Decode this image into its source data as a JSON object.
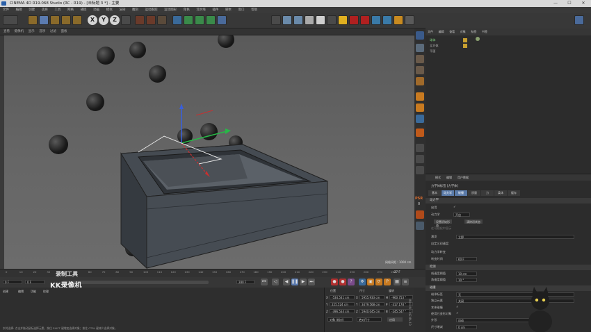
{
  "window": {
    "title": "CINEMA 4D R19.068 Studio (RC - R19) - [未标题 3 *] - 主要",
    "controls": [
      "—",
      "☐",
      "✕"
    ]
  },
  "menu": [
    "文件",
    "编辑",
    "创建",
    "选择",
    "工具",
    "网格",
    "捕捉",
    "动画",
    "模拟",
    "渲染",
    "雕刻",
    "运动跟踪",
    "运动图形",
    "角色",
    "流水线",
    "插件",
    "脚本",
    "窗口",
    "帮助"
  ],
  "toolbar": {
    "axis_x": "X",
    "axis_y": "Y",
    "axis_z": "Z"
  },
  "viewport": {
    "menu": [
      "查看",
      "摄像机",
      "显示",
      "选项",
      "过滤",
      "面板"
    ],
    "grid_label": "网格间距 : 1000 cm"
  },
  "objects": {
    "tabs": [
      "文件",
      "编辑",
      "查看",
      "对象",
      "标签",
      "书签"
    ],
    "items": [
      "球体",
      "立方体",
      "平面"
    ]
  },
  "attributes": {
    "menu": [
      "模式",
      "编辑",
      "用户数据"
    ],
    "title": "力学体标签 [力学体]",
    "tabs": [
      "基本",
      "动力学",
      "碰撞",
      "质量",
      "力",
      "柔体",
      "缓存"
    ],
    "section_dynamics": "动力学",
    "rows": [
      {
        "label": "启用",
        "value": "✓"
      },
      {
        "label": "动力学",
        "value": "开启"
      },
      {
        "label": "设置初始形态",
        "value": "清除初状态"
      },
      {
        "label": "在可视化中显示",
        "value": ""
      },
      {
        "label": "激发",
        "value": "立即"
      },
      {
        "label": "自定义初速度",
        "value": ""
      },
      {
        "label": "动力学转变",
        "value": ""
      },
      {
        "label": "转变时间",
        "value": "60 F"
      }
    ],
    "section_threshold": "检测",
    "threshold_rows": [
      {
        "label": "线速度阈值",
        "value": "10 cm"
      },
      {
        "label": "角速度阈值",
        "value": "10 °"
      }
    ],
    "section_collision": "碰撞",
    "collision_rows": [
      {
        "label": "继承标签",
        "value": "无"
      },
      {
        "label": "独立元素",
        "value": "关闭"
      },
      {
        "label": "本体碰撞",
        "value": "✓"
      },
      {
        "label": "使用已变形对象",
        "value": "✓"
      },
      {
        "label": "外形",
        "value": "自动"
      },
      {
        "label": "尺寸增减",
        "value": "0 cm"
      }
    ]
  },
  "timeline": {
    "ticks": [
      "0",
      "10",
      "20",
      "30",
      "40",
      "50",
      "60",
      "70",
      "80",
      "90",
      "100",
      "110",
      "120",
      "130",
      "140",
      "150",
      "160",
      "170",
      "180",
      "190",
      "200",
      "210",
      "220",
      "230",
      "240",
      "250",
      "260",
      "270",
      "280"
    ],
    "current": "0 F",
    "start": "0 F",
    "end": "280 F",
    "frame_counter": "27 F"
  },
  "watermark": {
    "line1": "录制工具",
    "line2": "KK录像机"
  },
  "bottom_menu": [
    "创建",
    "编辑",
    "功能",
    "纹理"
  ],
  "coords": {
    "headers": [
      "位置",
      "尺寸",
      "旋转"
    ],
    "rows": [
      [
        "X",
        "-534.541 cm",
        "X",
        "5955.933 cm",
        "H",
        "-960.753 °"
      ],
      [
        "Y",
        "225.524 cm",
        "Y",
        "3479.568 cm",
        "P",
        "-317.178 °"
      ],
      [
        "Z",
        "-396.534 cm",
        "Z",
        "5940.045 cm",
        "B",
        "-245.547 °"
      ]
    ],
    "mode1": "对象 (相对)",
    "mode2": "绝对尺寸",
    "apply": "应用"
  },
  "status": "实时选择: 点击并拖动鼠标选择元素。按住 SHIFT 键增加选择对象；按住 CTRL 键减少选择对象。",
  "logo_side": "MAXON CINEMA 4D",
  "panel_label": "PSR",
  "psr_value": "0"
}
